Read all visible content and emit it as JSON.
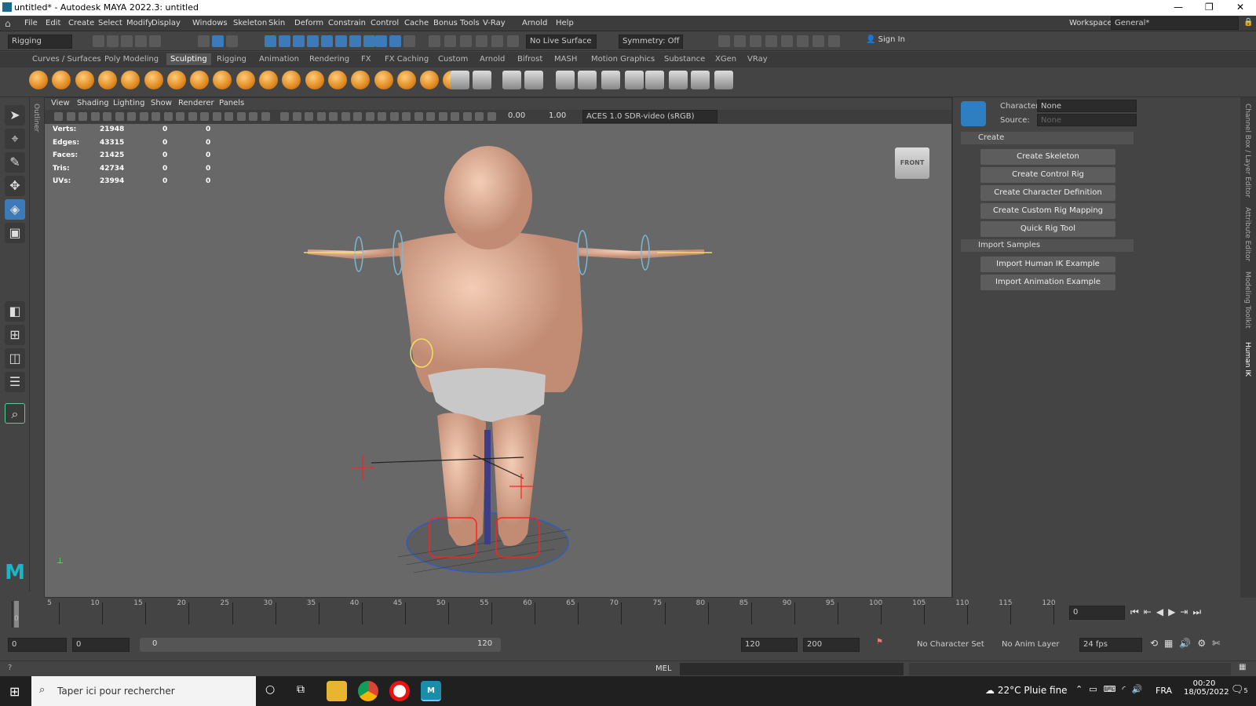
{
  "title": "untitled* - Autodesk MAYA 2022.3: untitled",
  "menus": [
    "File",
    "Edit",
    "Create",
    "Select",
    "Modify",
    "Display",
    "Windows",
    "Skeleton",
    "Skin",
    "Deform",
    "Constrain",
    "Control",
    "Cache",
    "Bonus Tools",
    "V-Ray",
    "Arnold",
    "Help"
  ],
  "workspace_label": "Workspace:",
  "workspace_value": "General*",
  "mode_menu": "Rigging",
  "live_surface": "No Live Surface",
  "symmetry": "Symmetry: Off",
  "sign_in": "Sign In",
  "shelf_tabs": [
    "Curves / Surfaces",
    "Poly Modeling",
    "Sculpting",
    "Rigging",
    "Animation",
    "Rendering",
    "FX",
    "FX Caching",
    "Custom",
    "Arnold",
    "Bifrost",
    "MASH",
    "Motion Graphics",
    "Substance",
    "XGen",
    "VRay"
  ],
  "active_shelf": "Sculpting",
  "panel_menus": [
    "View",
    "Shading",
    "Lighting",
    "Show",
    "Renderer",
    "Panels"
  ],
  "exposure": "0.00",
  "gamma": "1.00",
  "color_space": "ACES 1.0 SDR-video (sRGB)",
  "hud": [
    {
      "label": "Verts:",
      "v": "21948",
      "a": "0",
      "b": "0"
    },
    {
      "label": "Edges:",
      "v": "43315",
      "a": "0",
      "b": "0"
    },
    {
      "label": "Faces:",
      "v": "21425",
      "a": "0",
      "b": "0"
    },
    {
      "label": "Tris:",
      "v": "42734",
      "a": "0",
      "b": "0"
    },
    {
      "label": "UVs:",
      "v": "23994",
      "a": "0",
      "b": "0"
    }
  ],
  "viewcube": "FRONT",
  "outliner_label": "Outliner",
  "hik": {
    "character_label": "Character:",
    "character_value": "None",
    "source_label": "Source:",
    "source_value": "None",
    "create_section": "Create",
    "create_buttons": [
      "Create Skeleton",
      "Create Control Rig",
      "Create Character Definition",
      "Create Custom Rig Mapping",
      "Quick Rig Tool"
    ],
    "import_section": "Import Samples",
    "import_buttons": [
      "Import Human IK Example",
      "Import Animation Example"
    ]
  },
  "side_tabs": [
    "Channel Box / Layer Editor",
    "Attribute Editor",
    "Modeling Toolkit",
    "Human IK"
  ],
  "timeline_ticks": [
    "5",
    "10",
    "15",
    "20",
    "25",
    "30",
    "35",
    "40",
    "45",
    "50",
    "55",
    "60",
    "65",
    "70",
    "75",
    "80",
    "85",
    "90",
    "95",
    "100",
    "105",
    "110",
    "115",
    "120"
  ],
  "current_frame": "0",
  "timeline_start": "0",
  "range": {
    "start": "0",
    "inner_start": "0",
    "slider_start": "0",
    "slider_end": "120",
    "end": "120",
    "max": "200"
  },
  "no_character_set": "No Character Set",
  "no_anim_layer": "No Anim Layer",
  "fps": "24 fps",
  "cmd_lang": "MEL",
  "taskbar": {
    "search": "Taper ici pour rechercher",
    "temp": "22°C",
    "weather": "Pluie fine",
    "lang": "FRA",
    "time": "00:20",
    "date": "18/05/2022",
    "notif": "5"
  }
}
